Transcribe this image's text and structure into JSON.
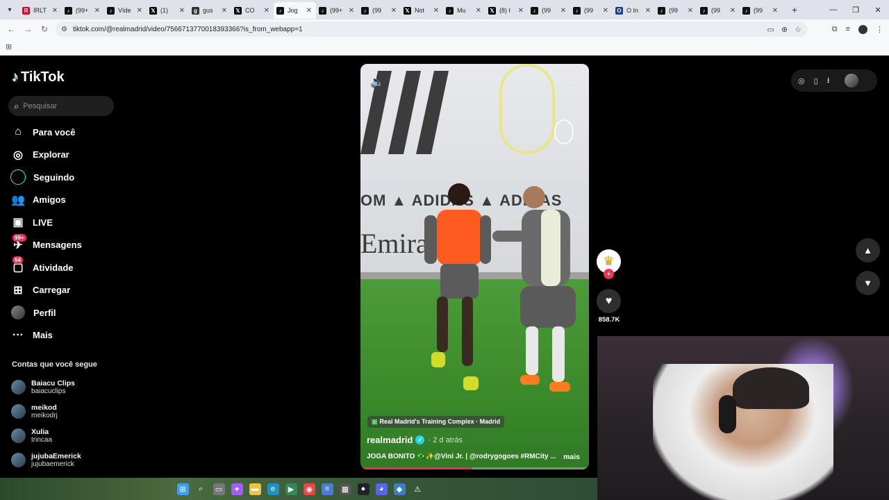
{
  "browser": {
    "tabs": [
      {
        "favicon": "IRL",
        "title": "IRLT",
        "kind": "irl"
      },
      {
        "favicon": "tiktok-icon",
        "title": "(99+",
        "kind": "tt"
      },
      {
        "favicon": "tiktok-icon",
        "title": "Víde",
        "kind": "tt"
      },
      {
        "favicon": "x-icon",
        "title": "(1) ",
        "kind": "x"
      },
      {
        "favicon": "gus-icon",
        "title": "gus",
        "kind": "gus"
      },
      {
        "favicon": "x-icon",
        "title": "CO",
        "kind": "x"
      },
      {
        "favicon": "tiktok-icon",
        "title": "Jog",
        "kind": "tt",
        "active": true
      },
      {
        "favicon": "tiktok-icon",
        "title": "(99+",
        "kind": "tt"
      },
      {
        "favicon": "tiktok-icon",
        "title": "(99",
        "kind": "tt"
      },
      {
        "favicon": "x-icon",
        "title": "Not",
        "kind": "x"
      },
      {
        "favicon": "tiktok-icon",
        "title": "Mu",
        "kind": "tt"
      },
      {
        "favicon": "x-icon",
        "title": "(8) I",
        "kind": "x"
      },
      {
        "favicon": "tiktok-icon",
        "title": "(99",
        "kind": "tt"
      },
      {
        "favicon": "tiktok-icon",
        "title": "(99",
        "kind": "tt"
      },
      {
        "favicon": "o-icon",
        "title": "O In",
        "kind": "o"
      },
      {
        "favicon": "tiktok-icon",
        "title": "(99",
        "kind": "tt"
      },
      {
        "favicon": "tiktok-icon",
        "title": "(99",
        "kind": "tt"
      },
      {
        "favicon": "tiktok-icon",
        "title": "(99",
        "kind": "tt"
      }
    ],
    "url": "tiktok.com/@realmadrid/video/7566713770018393366?is_from_webapp=1"
  },
  "sidebar": {
    "logo": "TikTok",
    "search_placeholder": "Pesquisar",
    "items": [
      {
        "icon": "home-icon",
        "glyph": "⌂",
        "label": "Para você"
      },
      {
        "icon": "compass-icon",
        "glyph": "◎",
        "label": "Explorar"
      },
      {
        "icon": "following-ring-icon",
        "glyph": "",
        "label": "Seguindo",
        "ring": true
      },
      {
        "icon": "friends-icon",
        "glyph": "👥",
        "label": "Amigos"
      },
      {
        "icon": "live-icon",
        "glyph": "▣",
        "label": "LIVE"
      },
      {
        "icon": "messages-icon",
        "glyph": "✈",
        "label": "Mensagens",
        "badge": "99+"
      },
      {
        "icon": "activity-icon",
        "glyph": "▢",
        "label": "Atividade",
        "badge": "64"
      },
      {
        "icon": "upload-icon",
        "glyph": "⊞",
        "label": "Carregar"
      },
      {
        "icon": "profile-icon",
        "glyph": "",
        "label": "Perfil",
        "pfp": true
      },
      {
        "icon": "more-icon",
        "glyph": "···",
        "label": "Mais"
      }
    ],
    "following_title": "Contas que você segue",
    "following": [
      {
        "name": "Baiacu Clips",
        "handle": "baiacuclips"
      },
      {
        "name": "meikod",
        "handle": "meikodrj"
      },
      {
        "name": "Xulia",
        "handle": "trincaa"
      },
      {
        "name": "jujubaEmerick",
        "handle": "jujubaemerick"
      }
    ]
  },
  "video": {
    "location": "Real Madrid's Training Complex · Madrid",
    "username": "realmadrid",
    "time": "· 2 d atrás",
    "caption": "JOGA BONITO 🇧🇷✨@Vini Jr. | @rodrygogoes #RMCity ...",
    "more_label": "mais",
    "ad_text": "OM ▲ ADIDAS ▲ ADIDAS",
    "sponsor_text": "Emirates",
    "progress": 0.49
  },
  "actions": {
    "like_count": "858.7K"
  },
  "colors": {
    "accent": "#fe2c55",
    "cyan": "#25f4ee",
    "verified": "#20d5ec"
  }
}
